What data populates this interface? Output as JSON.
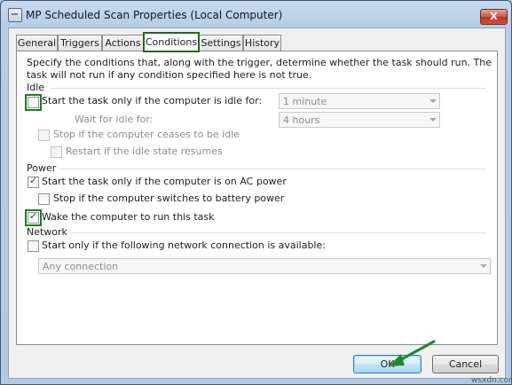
{
  "window": {
    "title": "MP Scheduled Scan Properties (Local Computer)",
    "close_glyph": "X"
  },
  "tabs": [
    {
      "label": "General",
      "active": false
    },
    {
      "label": "Triggers",
      "active": false
    },
    {
      "label": "Actions",
      "active": false
    },
    {
      "label": "Conditions",
      "active": true
    },
    {
      "label": "Settings",
      "active": false
    },
    {
      "label": "History",
      "active": false
    }
  ],
  "conditions": {
    "description": "Specify the conditions that, along with the trigger, determine whether the task should run.  The task will not run  if any condition specified here is not true.",
    "idle": {
      "heading": "Idle",
      "start_if_idle": {
        "label": "Start the task only if the computer is idle for:",
        "checked": false
      },
      "idle_for_value": "1 minute",
      "wait_label": "Wait for idle for:",
      "wait_value": "4 hours",
      "stop_if_not_idle": {
        "label": "Stop if the computer ceases to be idle",
        "checked": false
      },
      "restart_if_idle": {
        "label": "Restart if the idle state resumes",
        "checked": false
      }
    },
    "power": {
      "heading": "Power",
      "ac_power": {
        "label": "Start the task only if the computer is on AC power",
        "checked": true
      },
      "battery_stop": {
        "label": "Stop if the computer switches to battery power",
        "checked": false
      },
      "wake": {
        "label": "Wake the computer to run this task",
        "checked": true
      }
    },
    "network": {
      "heading": "Network",
      "start_if_network": {
        "label": "Start only if the following network connection is available:",
        "checked": false
      },
      "connection_value": "Any connection"
    }
  },
  "buttons": {
    "ok": "OK",
    "cancel": "Cancel"
  },
  "watermark": "wsxdn.com",
  "colors": {
    "highlight": "#1f7a1f",
    "titlebar": "#b9d1ea"
  },
  "check_glyph": "✓"
}
